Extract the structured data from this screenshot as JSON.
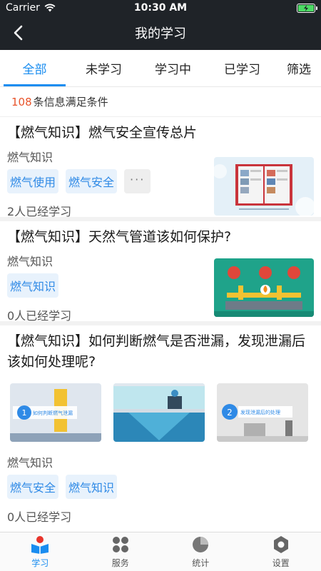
{
  "status_bar": {
    "carrier": "Carrier",
    "time": "10:30 AM"
  },
  "nav": {
    "title": "我的学习"
  },
  "tabs": [
    {
      "label": "全部"
    },
    {
      "label": "未学习"
    },
    {
      "label": "学习中"
    },
    {
      "label": "已学习"
    },
    {
      "label": "筛选"
    }
  ],
  "result": {
    "count": "108",
    "text": "条信息满足条件"
  },
  "items": [
    {
      "title": "【燃气知识】燃气安全宣传总片",
      "category": "燃气知识",
      "tags": [
        "燃气使用",
        "燃气安全"
      ],
      "more": "···",
      "footer": "2人已经学习"
    },
    {
      "title": "【燃气知识】天然气管道该如何保护?",
      "category": "燃气知识",
      "tags": [
        "燃气知识"
      ],
      "footer": "0人已经学习"
    },
    {
      "title": "【燃气知识】如何判断燃气是否泄漏，发现泄漏后该如何处理呢?",
      "category": "燃气知识",
      "tags": [
        "燃气安全",
        "燃气知识"
      ],
      "footer": "0人已经学习",
      "thumb_captions": [
        "如何判断燃气泄漏",
        "发现泄漏后的处理"
      ]
    }
  ],
  "tab_bar": [
    {
      "label": "学习",
      "icon": "study-icon"
    },
    {
      "label": "服务",
      "icon": "service-icon"
    },
    {
      "label": "统计",
      "icon": "statistics-icon"
    },
    {
      "label": "设置",
      "icon": "settings-icon"
    }
  ],
  "colors": {
    "accent": "#1a8df0",
    "count": "#e8542b",
    "header": "#1f2328"
  }
}
